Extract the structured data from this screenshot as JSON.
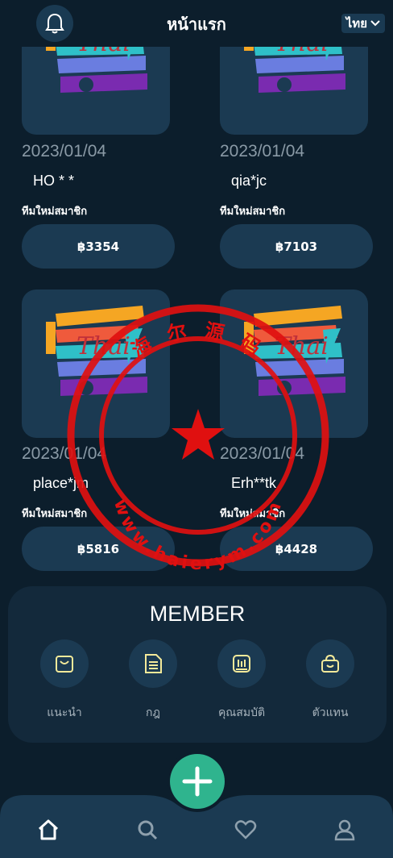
{
  "header": {
    "title": "หน้าแรก",
    "language": "ไทย"
  },
  "cards": [
    {
      "date": "2023/01/04",
      "name": "HO * *",
      "team": "ทีมใหม่สมาชิก",
      "amount": "฿3354",
      "logo_text": "Thai"
    },
    {
      "date": "2023/01/04",
      "name": "qia*jc",
      "team": "ทีมใหม่สมาชิก",
      "amount": "฿7103",
      "logo_text": "Thai"
    },
    {
      "date": "2023/01/04",
      "name": "place*jm",
      "team": "ทีมใหม่สมาชิก",
      "amount": "฿5816",
      "logo_text": "Thai"
    },
    {
      "date": "2023/01/04",
      "name": "Erh**tk",
      "team": "ทีมใหม่สมาชิก",
      "amount": "฿4428",
      "logo_text": "Thai"
    }
  ],
  "member": {
    "title": "MEMBER",
    "items": [
      {
        "label": "แนะนำ",
        "icon": "bag-icon"
      },
      {
        "label": "กฎ",
        "icon": "document-icon"
      },
      {
        "label": "คุณสมบัติ",
        "icon": "chart-icon"
      },
      {
        "label": "ตัวแทน",
        "icon": "shopping-basket-icon"
      }
    ]
  },
  "watermark": {
    "top_text": "海 尔 源 码",
    "bottom_text": "www.haierym.com"
  },
  "bottom_nav": {
    "items": [
      "home-icon",
      "search-icon",
      "heart-icon",
      "user-icon"
    ]
  },
  "colors": {
    "background": "#0c1e2c",
    "card": "#1b3a52",
    "accent": "#2fb48e",
    "stamp": "#e01010",
    "icon_yellow": "#f4ea9a"
  }
}
